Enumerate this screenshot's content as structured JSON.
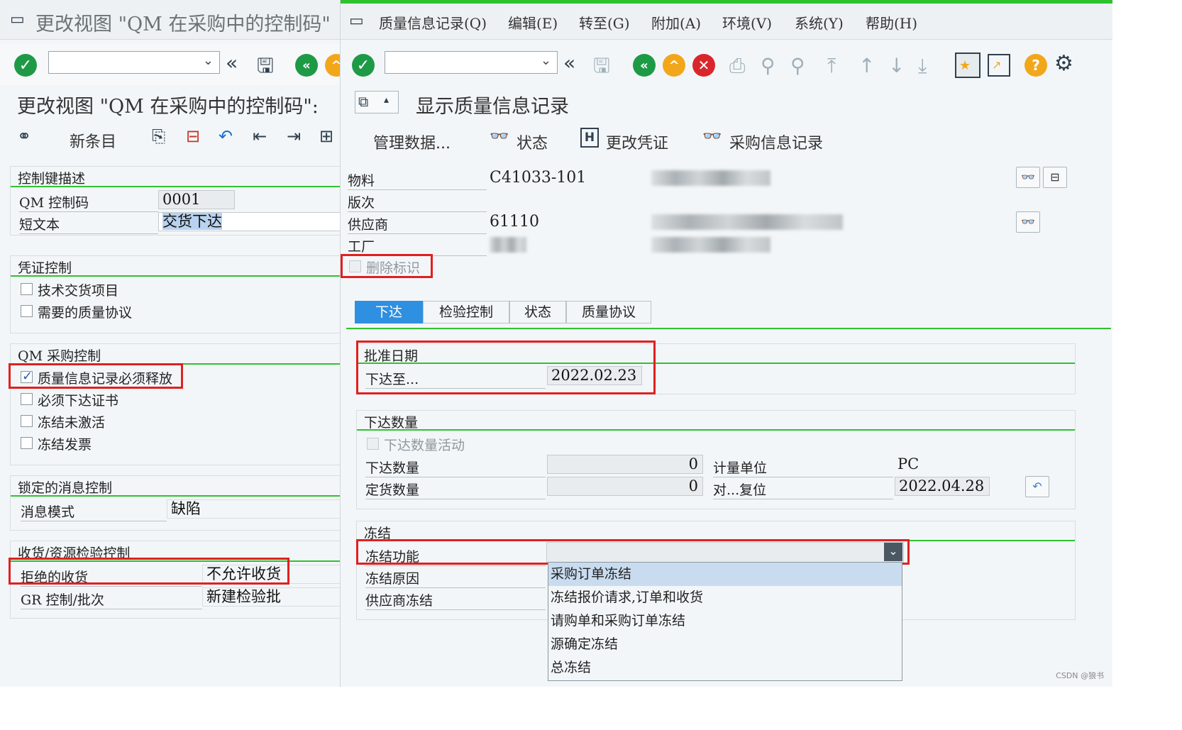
{
  "left": {
    "title": "更改视图 \"QM 在采购中的控制码\"",
    "heading": "更改视图 \"QM 在采购中的控制码\":",
    "new_entries": "新条目",
    "groups": {
      "control_key_desc": {
        "title": "控制键描述",
        "qm_control_label": "QM 控制码",
        "qm_control_value": "0001",
        "short_text_label": "短文本",
        "short_text_value": "交货下达"
      },
      "doc_control": {
        "title": "凭证控制",
        "items": [
          "技术交货项目",
          "需要的质量协议"
        ]
      },
      "qm_purchase": {
        "title": "QM 采购控制",
        "items": [
          "质量信息记录必须释放",
          "必须下达证书",
          "冻结未激活",
          "冻结发票"
        ]
      },
      "locked_msg": {
        "title": "锁定的消息控制",
        "msg_mode_label": "消息模式",
        "msg_mode_value": "缺陷"
      },
      "gr_control": {
        "title": "收货/资源检验控制",
        "rejected_label": "拒绝的收货",
        "rejected_value": "不允许收货",
        "gr_batch_label": "GR 控制/批次",
        "gr_batch_value": "新建检验批"
      }
    }
  },
  "right": {
    "menu": [
      "质量信息记录(Q)",
      "编辑(E)",
      "转至(G)",
      "附加(A)",
      "环境(V)",
      "系统(Y)",
      "帮助(H)"
    ],
    "heading": "显示质量信息记录",
    "app_toolbar": [
      "管理数据...",
      "状态",
      "更改凭证",
      "采购信息记录"
    ],
    "header_fields": {
      "material_label": "物料",
      "material_value": "C41033-101",
      "revision_label": "版次",
      "vendor_label": "供应商",
      "vendor_value": "61110",
      "plant_label": "工厂",
      "delete_flag_label": "删除标识"
    },
    "tabs": [
      "下达",
      "检验控制",
      "状态",
      "质量协议"
    ],
    "approval": {
      "title": "批准日期",
      "release_until_label": "下达至...",
      "release_until_value": "2022.02.23"
    },
    "release_qty": {
      "title": "下达数量",
      "active_label": "下达数量活动",
      "release_qty_label": "下达数量",
      "release_qty_value": "0",
      "ordered_qty_label": "定货数量",
      "ordered_qty_value": "0",
      "uom_label": "计量单位",
      "uom_value": "PC",
      "reset_label": "对...复位",
      "reset_value": "2022.04.28"
    },
    "freeze": {
      "title": "冻结",
      "function_label": "冻结功能",
      "function_value": "",
      "reason_label": "冻结原因",
      "vendor_block_label": "供应商冻结",
      "options": [
        "采购订单冻结",
        "冻结报价请求,订单和收货",
        "请购单和采购订单冻结",
        "源确定冻结",
        "总冻结"
      ],
      "selected_index": 0
    }
  },
  "watermark": "CSDN @狼书",
  "colors": {
    "accent_green": "#2fc22f",
    "ok_green": "#1e9a46",
    "tab_blue": "#2f8fe0",
    "annotation_red": "#e02020"
  }
}
